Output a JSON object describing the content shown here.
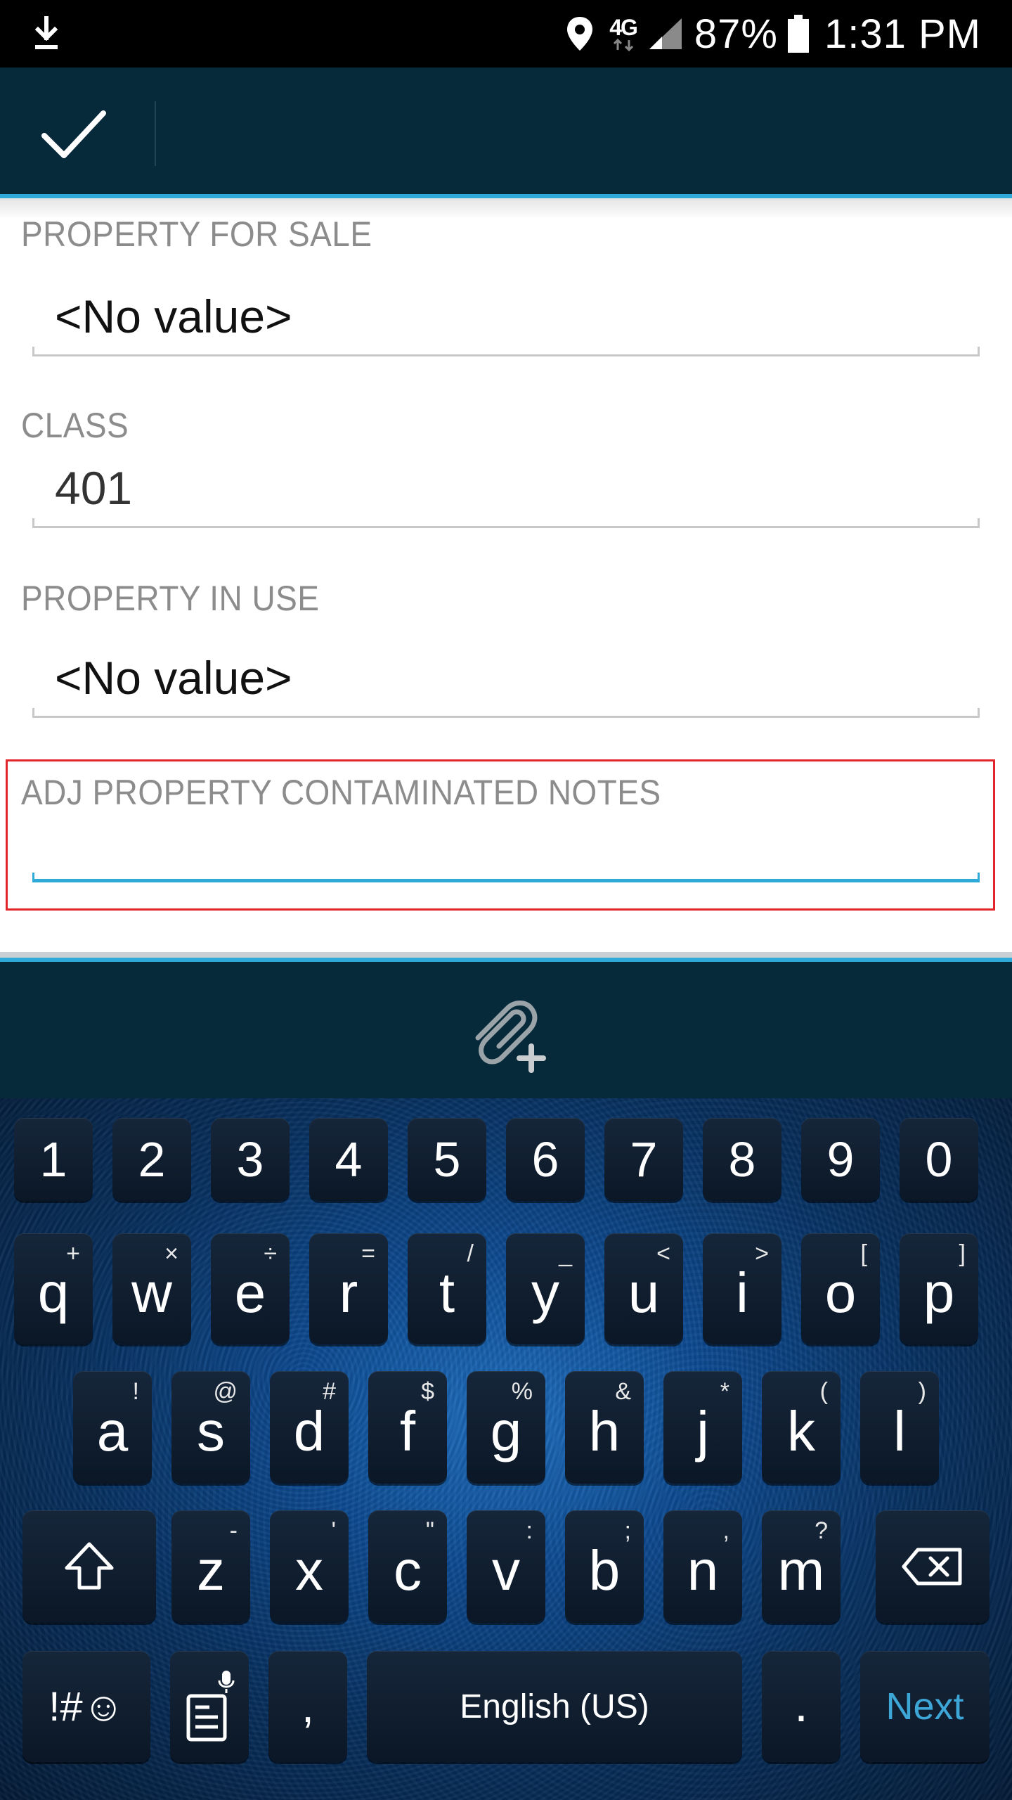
{
  "status_bar": {
    "network": "4G",
    "battery_percent": "87%",
    "time": "1:31 PM"
  },
  "app_bar": {
    "confirm_icon": "checkmark-icon"
  },
  "form": {
    "fields": [
      {
        "label": "PROPERTY FOR SALE",
        "value": "<No value>"
      },
      {
        "label": "CLASS",
        "value": "401"
      },
      {
        "label": "PROPERTY IN USE",
        "value": "<No value>"
      },
      {
        "label": "ADJ PROPERTY CONTAMINATED NOTES",
        "value": ""
      }
    ]
  },
  "attach_bar": {
    "attach_icon": "paperclip-add-icon"
  },
  "keyboard": {
    "number_row": [
      "1",
      "2",
      "3",
      "4",
      "5",
      "6",
      "7",
      "8",
      "9",
      "0"
    ],
    "row1": [
      {
        "key": "q",
        "sub": "+"
      },
      {
        "key": "w",
        "sub": "×"
      },
      {
        "key": "e",
        "sub": "÷"
      },
      {
        "key": "r",
        "sub": "="
      },
      {
        "key": "t",
        "sub": "/"
      },
      {
        "key": "y",
        "sub": "_"
      },
      {
        "key": "u",
        "sub": "<"
      },
      {
        "key": "i",
        "sub": ">"
      },
      {
        "key": "o",
        "sub": "["
      },
      {
        "key": "p",
        "sub": "]"
      }
    ],
    "row2": [
      {
        "key": "a",
        "sub": "!"
      },
      {
        "key": "s",
        "sub": "@"
      },
      {
        "key": "d",
        "sub": "#"
      },
      {
        "key": "f",
        "sub": "$"
      },
      {
        "key": "g",
        "sub": "%"
      },
      {
        "key": "h",
        "sub": "&"
      },
      {
        "key": "j",
        "sub": "*"
      },
      {
        "key": "k",
        "sub": "("
      },
      {
        "key": "l",
        "sub": ")"
      }
    ],
    "row3": [
      {
        "key": "z",
        "sub": "-"
      },
      {
        "key": "x",
        "sub": "'"
      },
      {
        "key": "c",
        "sub": "\""
      },
      {
        "key": "v",
        "sub": ":"
      },
      {
        "key": "b",
        "sub": ";"
      },
      {
        "key": "n",
        "sub": ","
      },
      {
        "key": "m",
        "sub": "?"
      }
    ],
    "symbols_label": "!#☺",
    "comma": ",",
    "space_label": "English (US)",
    "period": ".",
    "next_label": "Next",
    "colors": {
      "next": "#3ea6d6",
      "accent": "#2fa9d8",
      "highlight": "#e3242b"
    }
  }
}
